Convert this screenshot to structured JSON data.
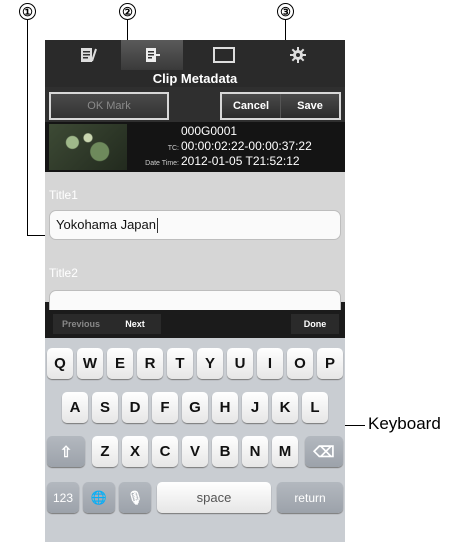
{
  "callouts": [
    "①",
    "②",
    "③"
  ],
  "keyboard_label": "Keyboard",
  "toolbar": {
    "title": "Clip Metadata"
  },
  "actions": {
    "ok_mark": "OK Mark",
    "cancel": "Cancel",
    "save": "Save"
  },
  "metadata": {
    "rows": [
      {
        "key": "",
        "value": "000G0001"
      },
      {
        "key": "TC:",
        "value": "00:00:02:22-00:00:37:22"
      },
      {
        "key": "Date Time:",
        "value": "2012-01-05 T21:52:12"
      }
    ]
  },
  "form": {
    "title1_label": "Title1",
    "title1_value": "Yokohama Japan",
    "title2_label": "Title2",
    "title2_value": ""
  },
  "accessory": {
    "previous": "Previous",
    "next": "Next",
    "done": "Done"
  },
  "keyboard": {
    "row1": [
      "Q",
      "W",
      "E",
      "R",
      "T",
      "Y",
      "U",
      "I",
      "O",
      "P"
    ],
    "row2": [
      "A",
      "S",
      "D",
      "F",
      "G",
      "H",
      "J",
      "K",
      "L"
    ],
    "row3": [
      "Z",
      "X",
      "C",
      "V",
      "B",
      "N",
      "M"
    ],
    "shift": "⇧",
    "delete": "⌫",
    "numbers": "123",
    "globe": "🌐",
    "mic": "🎙",
    "space": "space",
    "return": "return"
  }
}
